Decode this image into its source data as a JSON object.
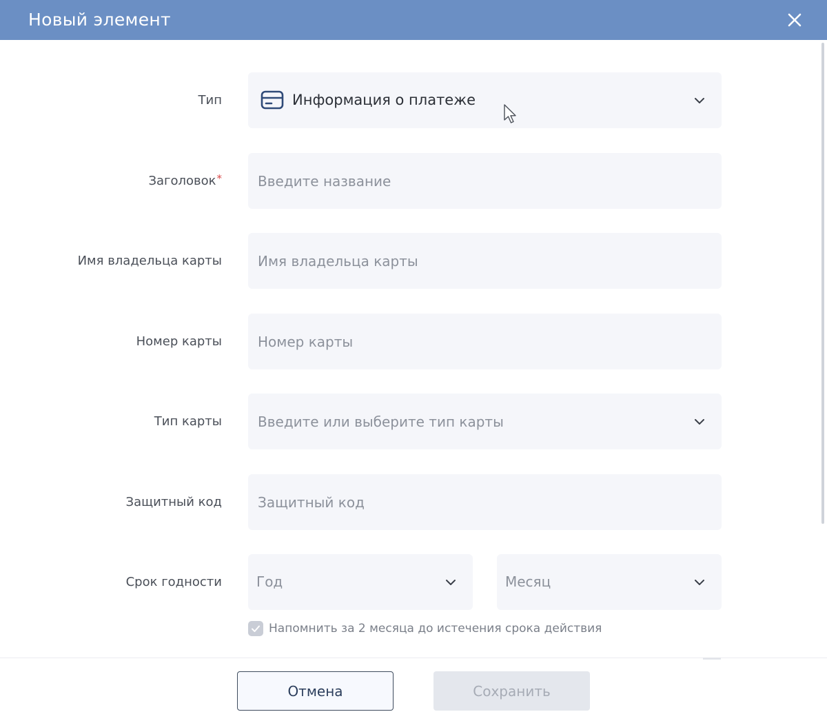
{
  "dialog": {
    "title": "Новый элемент",
    "close_icon": "close-icon"
  },
  "colors": {
    "titlebar": "#6b8fc4",
    "field_bg": "#f5f6fa",
    "required_mark": "#d94848",
    "save_disabled_bg": "#e4e7ed"
  },
  "form": {
    "type": {
      "label": "Тип",
      "value": "Информация о платеже",
      "icon": "credit-card-icon"
    },
    "title_field": {
      "label": "Заголовок",
      "required_mark": "*",
      "placeholder": "Введите название"
    },
    "cardholder": {
      "label": "Имя владельца карты",
      "placeholder": "Имя владельца карты"
    },
    "card_number": {
      "label": "Номер карты",
      "placeholder": "Номер карты"
    },
    "card_type": {
      "label": "Тип карты",
      "placeholder": "Введите или выберите тип карты"
    },
    "security_code": {
      "label": "Защитный код",
      "placeholder": "Защитный код"
    },
    "expiry": {
      "label": "Срок годности",
      "year_placeholder": "Год",
      "month_placeholder": "Месяц"
    },
    "reminder": {
      "checked": true,
      "label": "Напомнить за 2 месяца до истечения срока действия"
    }
  },
  "footer": {
    "cancel_label": "Отмена",
    "save_label": "Сохранить",
    "save_enabled": false
  }
}
